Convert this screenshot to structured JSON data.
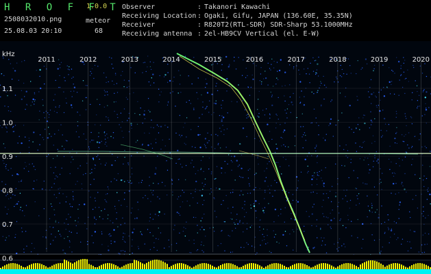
{
  "header": {
    "logo_text": "H R O F F T",
    "version": "1.0.0",
    "filename": "2508032010.png",
    "meteor_label": "meteor",
    "datetime": "25.08.03 20:10",
    "meteor_count": "68"
  },
  "info": [
    {
      "key": "Observer",
      "sep": ":",
      "value": "Takanori Kawachi"
    },
    {
      "key": "Receiving Location",
      "sep": ":",
      "value": "Ogaki, Gifu, JAPAN (136.60E, 35.35N)"
    },
    {
      "key": "Receiver",
      "sep": ":",
      "value": "R820T2(RTL-SDR) SDR-Sharp 53.1000MHz"
    },
    {
      "key": "Receiving antenna",
      "sep": ":",
      "value": "2el-HB9CV Vertical (el. E-W)"
    }
  ],
  "plot": {
    "unit": "kHz",
    "year_labels": [
      "2011",
      "2012",
      "2013",
      "2014",
      "2015",
      "2016",
      "2017",
      "2018",
      "2019",
      "2020"
    ],
    "y_labels": [
      "1.1",
      "1.0",
      "0.9",
      "0.8",
      "0.7",
      "0.6"
    ],
    "colors": {
      "background": "#01060e",
      "grid": "#ffffff",
      "noise_blue": "#2b63ff",
      "noise_cyan": "#45e8ff",
      "trace_green": "#60ff88",
      "trace_yellow": "#fff200",
      "footer_yellow": "#ffff00",
      "footer_cyan": "#00ffff"
    }
  }
}
